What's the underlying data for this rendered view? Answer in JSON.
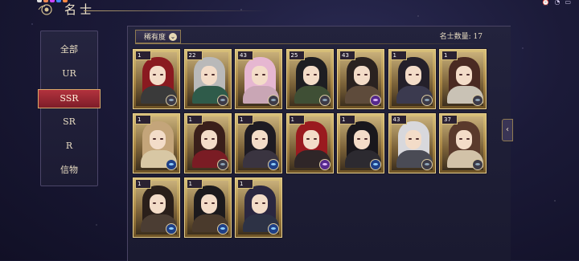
{
  "header": {
    "title": "名士"
  },
  "sidebar": {
    "items": [
      {
        "label": "全部"
      },
      {
        "label": "UR"
      },
      {
        "label": "SSR"
      },
      {
        "label": "SR"
      },
      {
        "label": "R"
      },
      {
        "label": "信物"
      }
    ],
    "active_index": 2
  },
  "filter": {
    "label": "稀有度",
    "icon": "chevron-down-icon"
  },
  "count": {
    "label": "名士数量: 17"
  },
  "cards": [
    {
      "level": "1",
      "hair": "#8a1a20",
      "robe": "#3a3a3a",
      "badge": "gray"
    },
    {
      "level": "22",
      "hair": "#b9b9b9",
      "robe": "#2f5b4a",
      "badge": "gray"
    },
    {
      "level": "43",
      "hair": "#e6b7d1",
      "robe": "#c9a6b5",
      "badge": "gray"
    },
    {
      "level": "25",
      "hair": "#1e1e22",
      "robe": "#3f4f35",
      "badge": "gray"
    },
    {
      "level": "43",
      "hair": "#2a2220",
      "robe": "#5e4b3b",
      "badge": "purple"
    },
    {
      "level": "1",
      "hair": "#24202a",
      "robe": "#3b3a4f",
      "badge": "gray"
    },
    {
      "level": "1",
      "hair": "#4a2a22",
      "robe": "#c9c2b5",
      "badge": "gray"
    },
    {
      "level": "1",
      "hair": "#c4a57a",
      "robe": "#d8c7a4",
      "badge": "blue"
    },
    {
      "level": "1",
      "hair": "#3a1f1a",
      "robe": "#7a1c24",
      "badge": "gray"
    },
    {
      "level": "1",
      "hair": "#1e1b22",
      "robe": "#3a3440",
      "badge": "blue"
    },
    {
      "level": "1",
      "hair": "#9a1a1f",
      "robe": "#2f2628",
      "badge": "purple"
    },
    {
      "level": "1",
      "hair": "#19171c",
      "robe": "#2c2a30",
      "badge": "blue"
    },
    {
      "level": "43",
      "hair": "#d8d8dc",
      "robe": "#4a4b55",
      "badge": "gray"
    },
    {
      "level": "37",
      "hair": "#5a3a2c",
      "robe": "#d2c2a8",
      "badge": "gray"
    },
    {
      "level": "1",
      "hair": "#2a1f1a",
      "robe": "#4b3d33",
      "badge": "blue"
    },
    {
      "level": "1",
      "hair": "#1c1a1d",
      "robe": "#4a3a2c",
      "badge": "blue"
    },
    {
      "level": "1",
      "hair": "#2b2740",
      "robe": "#2d3245",
      "badge": "blue"
    }
  ],
  "colors": {
    "active_tab": "#b2323d",
    "gold_border": "#d8c07a"
  }
}
